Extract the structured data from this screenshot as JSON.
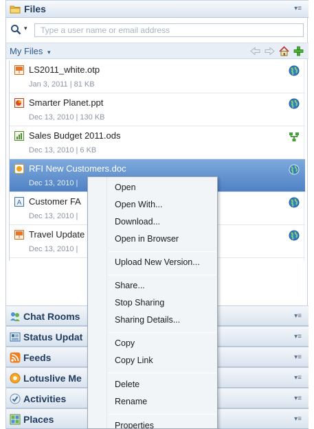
{
  "files_panel": {
    "title": "Files",
    "menu_glyph": "▾≡",
    "icon": "folder-icon"
  },
  "search": {
    "placeholder": "Type a user name or email address",
    "caret": "▾",
    "icon": "search-icon"
  },
  "my_files": {
    "label": "My Files",
    "caret": "▾",
    "tools": [
      "back-arrow-icon",
      "forward-arrow-icon",
      "home-icon",
      "add-icon"
    ]
  },
  "files": [
    {
      "name": "LS2011_white.otp",
      "meta": "Jan 3, 2011 | 81 KB",
      "icon": "presentation-template-icon",
      "share": "globe-icon",
      "selected": false
    },
    {
      "name": "Smarter Planet.ppt",
      "meta": "Dec 13, 2010 | 130 KB",
      "icon": "powerpoint-icon",
      "share": "globe-icon",
      "selected": false
    },
    {
      "name": "Sales Budget 2011.ods",
      "meta": "Dec 13, 2010 | 6 KB",
      "icon": "spreadsheet-icon",
      "share": "network-icon",
      "selected": false
    },
    {
      "name": "RFI New Customers.doc",
      "meta": "Dec 13, 2010 |",
      "icon": "document-icon",
      "share": "globe-icon",
      "selected": true
    },
    {
      "name": "Customer FA",
      "meta": "Dec 13, 2010 |",
      "icon": "text-file-icon",
      "share": "globe-icon",
      "selected": false
    },
    {
      "name": "Travel Update",
      "meta": "Dec 13, 2010 |",
      "icon": "presentation-template-icon",
      "share": "globe-icon",
      "selected": false
    }
  ],
  "bottom_panels": [
    {
      "title": "Chat Rooms",
      "icon": "chat-rooms-icon",
      "menu_glyph": "▾≡"
    },
    {
      "title": "Status Updat",
      "icon": "status-updates-icon",
      "menu_glyph": "▾≡"
    },
    {
      "title": "Feeds",
      "icon": "rss-feed-icon",
      "menu_glyph": "▾≡"
    },
    {
      "title": "Lotuslive Me",
      "icon": "lotuslive-icon",
      "menu_glyph": "▾≡"
    },
    {
      "title": "Activities",
      "icon": "activities-icon",
      "menu_glyph": "▾≡"
    },
    {
      "title": "Places",
      "icon": "places-icon",
      "menu_glyph": "▾≡"
    }
  ],
  "context_menu": {
    "items": [
      "Open",
      "Open With...",
      "Download...",
      "Open in Browser",
      "Upload New Version...",
      "Share...",
      "Stop Sharing",
      "Sharing Details...",
      "Copy",
      "Copy Link",
      "Delete",
      "Rename",
      "Properties"
    ]
  }
}
